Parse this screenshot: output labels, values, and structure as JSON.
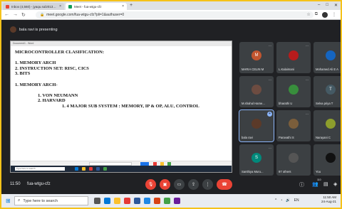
{
  "browser": {
    "tabs": [
      {
        "label": "Inbox (4,560) - jyaqu.sul2013@...",
        "active": false,
        "favicon_color": "#ea4335"
      },
      {
        "label": "Meet - fua-wtgu-cfz",
        "active": true,
        "favicon_color": "#0f9d58"
      }
    ],
    "new_tab": "+",
    "url": "meet.google.com/fua-wtgu-cfz?pli=1&authuser=0"
  },
  "meet": {
    "presenting_text": "bala ravi is presenting",
    "slide": {
      "window_title": "Document1 - Word",
      "lines": [
        {
          "text": "MICROCONTROLLER CLASIFICATION:",
          "indent": 0
        },
        {
          "text": "",
          "indent": 0
        },
        {
          "text": "1. MEMORY ARCH",
          "indent": 0
        },
        {
          "text": "2. INSTRUCTION SET: RISC, CICS",
          "indent": 0
        },
        {
          "text": "3. BITS",
          "indent": 0
        },
        {
          "text": "",
          "indent": 0
        },
        {
          "text": "1. MEMORY ARCH-",
          "indent": 0
        },
        {
          "text": "",
          "indent": 0
        },
        {
          "text": "1. VON NEUMANN",
          "indent": 1
        },
        {
          "text": "2. HARVARD",
          "indent": 1
        },
        {
          "text": "1. 4 MAJOR SUB SYSTEM : MEMORY, IP & OP, ALU, CONTROL",
          "indent": 2
        }
      ],
      "search_placeholder": "Type here to search"
    },
    "participants": [
      {
        "name": "MARIA CELIN M",
        "initial": "M",
        "color": "#c2552f"
      },
      {
        "name": "L.Kalaimani",
        "initial": "",
        "color": "#b71c1c"
      },
      {
        "name": "Mohamed Ali E A",
        "initial": "",
        "color": "#1565c0"
      },
      {
        "name": "M.shahul Hame...",
        "initial": "",
        "color": "#6d4c41"
      },
      {
        "name": "bharathi U",
        "initial": "",
        "color": "#388e3c"
      },
      {
        "name": "Selva priya T",
        "initial": "T",
        "color": "#455a64"
      },
      {
        "name": "bala ravi",
        "initial": "",
        "color": "#5b3a29"
      },
      {
        "name": "Paravathi S",
        "initial": "",
        "color": "#7b5e3b"
      },
      {
        "name": "Narayani C",
        "initial": "",
        "color": "#8d9e2c"
      },
      {
        "name": "Santhiya Muru...",
        "initial": "S",
        "color": "#00897b"
      },
      {
        "name": "97 others",
        "initial": "",
        "color": "#555"
      },
      {
        "name": "You",
        "initial": "",
        "color": "#111"
      }
    ],
    "bar": {
      "time": "11:50",
      "meeting_code": "fua-wtgu-cfz",
      "participant_count": "110"
    }
  },
  "taskbar": {
    "search_placeholder": "Type here to search",
    "time": "11:50 AM",
    "date": "24-Aug-21"
  }
}
